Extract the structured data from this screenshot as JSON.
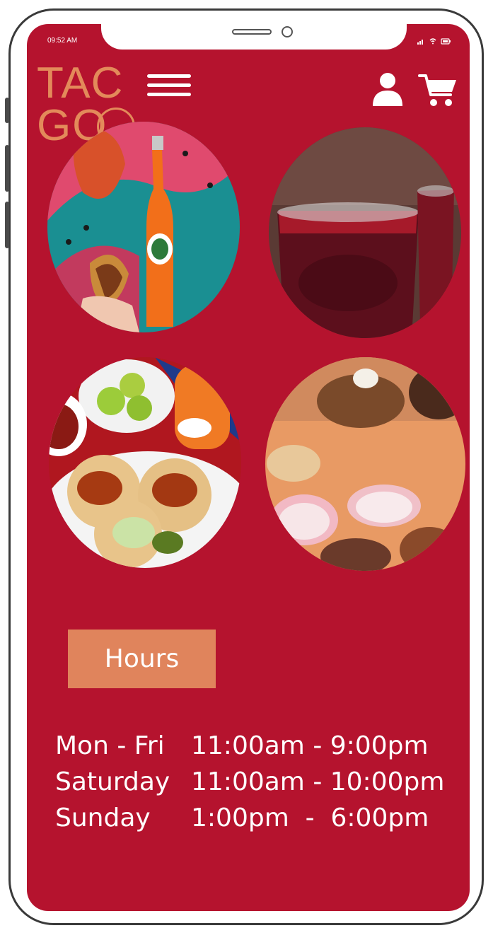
{
  "status_bar": {
    "time": "09:52 AM"
  },
  "brand": {
    "logo_line1": "TAC",
    "logo_line2": "GO"
  },
  "header": {
    "menu_icon": "hamburger-menu-icon",
    "user_icon": "user-icon",
    "cart_icon": "shopping-cart-icon"
  },
  "photos": [
    {
      "alt": "tacos and jarritos"
    },
    {
      "alt": "red agua fresca"
    },
    {
      "alt": "tacos al pastor plate"
    },
    {
      "alt": "rice and beans plate"
    }
  ],
  "hours_button": {
    "label": "Hours"
  },
  "hours": [
    {
      "day": "Mon - Fri",
      "time": "11:00am - 9:00pm"
    },
    {
      "day": "Saturday",
      "time": "11:00am - 10:00pm"
    },
    {
      "day": "Sunday",
      "time": "1:00pm  -  6:00pm"
    }
  ],
  "colors": {
    "background": "#b5132e",
    "accent": "#e0845c",
    "text": "#ffffff"
  }
}
